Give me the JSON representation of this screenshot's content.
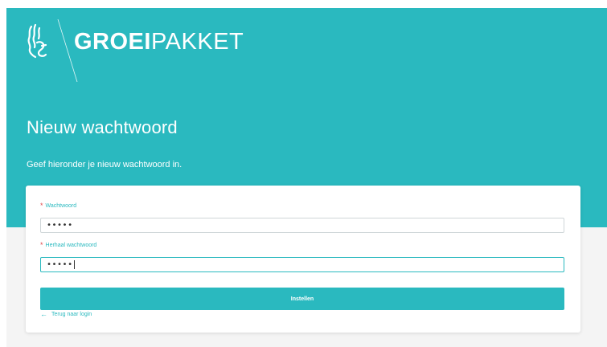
{
  "brand": {
    "logo_bold": "GROEI",
    "logo_light": "PAKKET",
    "primary_color": "#2ab9bf",
    "required_color": "#e0494b"
  },
  "header": {
    "title": "Nieuw wachtwoord",
    "subtitle": "Geef hieronder je nieuw wachtwoord in."
  },
  "form": {
    "required_marker": "*",
    "password": {
      "label": "Wachtwoord",
      "value": "•••••"
    },
    "confirm_password": {
      "label": "Herhaal wachtwoord",
      "value": "•••••"
    },
    "submit_label": "Instellen",
    "back_icon": "arrow-left-icon",
    "back_arrow": "←",
    "back_label": "Terug naar login"
  }
}
